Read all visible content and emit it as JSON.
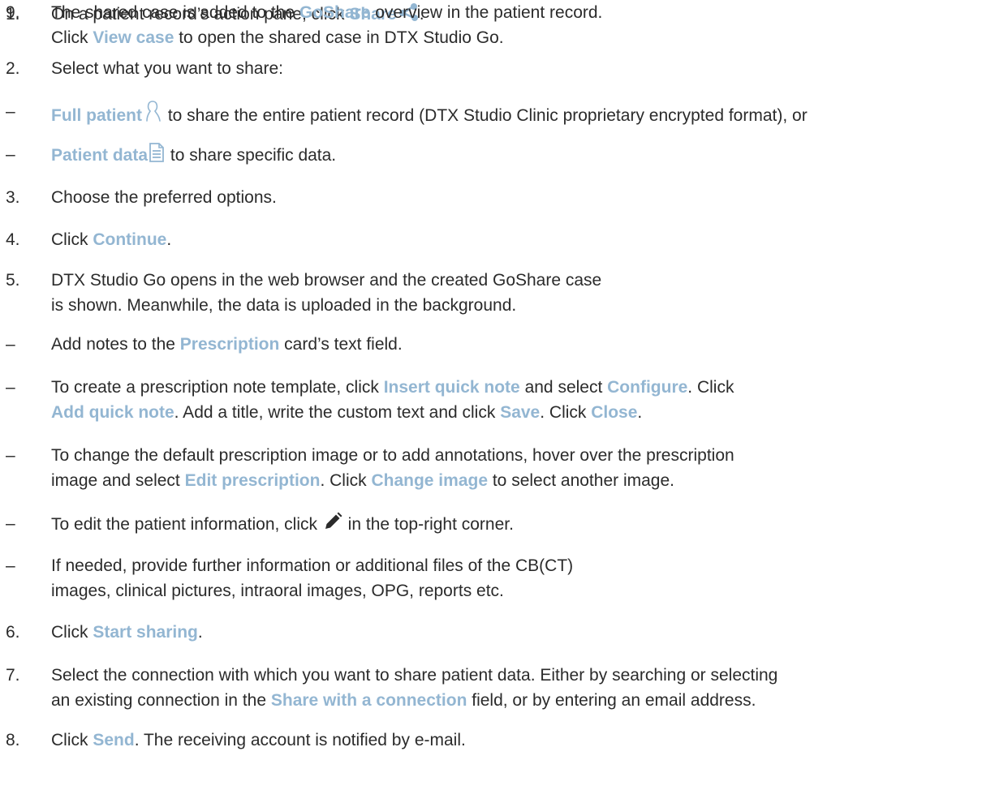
{
  "steps": [
    {
      "marker": "1.",
      "lines": [
        [
          {
            "t": "On a patient record’s action pane, click "
          },
          {
            "t": "Share",
            "hl": true
          },
          {
            "icon": "share-icon"
          },
          {
            "t": "."
          }
        ]
      ]
    },
    {
      "marker": "2.",
      "lines": [
        [
          {
            "t": "Select what you want to share:"
          }
        ]
      ]
    },
    {
      "marker": "–",
      "lines": [
        [
          {
            "t": "Full patient",
            "hl": true
          },
          {
            "icon": "person-outline-icon"
          },
          {
            "t": " to share the entire patient record (DTX Studio Clinic proprietary encrypted format), or"
          }
        ]
      ]
    },
    {
      "marker": "–",
      "lines": [
        [
          {
            "t": "Patient data",
            "hl": true
          },
          {
            "icon": "document-icon"
          },
          {
            "t": " to share specific data."
          }
        ]
      ]
    },
    {
      "marker": "3.",
      "lines": [
        [
          {
            "t": "Choose the preferred options."
          }
        ]
      ]
    },
    {
      "marker": "4.",
      "lines": [
        [
          {
            "t": "Click "
          },
          {
            "t": "Continue",
            "hl": true
          },
          {
            "t": "."
          }
        ]
      ]
    },
    {
      "marker": "5.",
      "lines": [
        [
          {
            "t": "DTX Studio Go opens in the web browser and the created GoShare case"
          }
        ],
        [
          {
            "t": "is shown. Meanwhile, the data is uploaded in the background."
          }
        ]
      ]
    },
    {
      "marker": "–",
      "lines": [
        [
          {
            "t": "Add notes to the "
          },
          {
            "t": "Prescription",
            "hl": true
          },
          {
            "t": " card’s text field."
          }
        ]
      ]
    },
    {
      "marker": "–",
      "lines": [
        [
          {
            "t": "To create a prescription note template, click "
          },
          {
            "t": "Insert quick note",
            "hl": true
          },
          {
            "t": " and select "
          },
          {
            "t": "Configure",
            "hl": true
          },
          {
            "t": ". Click"
          }
        ],
        [
          {
            "t": "Add quick note",
            "hl": true
          },
          {
            "t": ". Add a title, write the custom text and click "
          },
          {
            "t": "Save",
            "hl": true
          },
          {
            "t": ". Click "
          },
          {
            "t": "Close",
            "hl": true
          },
          {
            "t": "."
          }
        ]
      ]
    },
    {
      "marker": "–",
      "lines": [
        [
          {
            "t": "To change the default prescription image or to add annotations, hover over the prescription"
          }
        ],
        [
          {
            "t": "image and select "
          },
          {
            "t": "Edit prescription",
            "hl": true
          },
          {
            "t": ". Click "
          },
          {
            "t": "Change image",
            "hl": true
          },
          {
            "t": " to select another image."
          }
        ]
      ]
    },
    {
      "marker": "–",
      "lines": [
        [
          {
            "t": "To edit the patient information, click "
          },
          {
            "icon": "pencil-icon"
          },
          {
            "t": " in the top-right corner."
          }
        ]
      ]
    },
    {
      "marker": "–",
      "lines": [
        [
          {
            "t": "If needed, provide further information or additional files of the CB(CT)"
          }
        ],
        [
          {
            "t": "images, clinical pictures, intraoral images, OPG, reports etc."
          }
        ]
      ]
    },
    {
      "marker": "6.",
      "lines": [
        [
          {
            "t": "Click "
          },
          {
            "t": "Start sharing",
            "hl": true
          },
          {
            "t": "."
          }
        ]
      ]
    },
    {
      "marker": "7.",
      "lines": [
        [
          {
            "t": "Select the connection with which you want to share patient data. Either by searching or selecting"
          }
        ],
        [
          {
            "t": "an existing connection in the "
          },
          {
            "t": "Share with a connection",
            "hl": true
          },
          {
            "t": " field, or by entering an email address."
          }
        ]
      ]
    },
    {
      "marker": "8.",
      "lines": [
        [
          {
            "t": "Click "
          },
          {
            "t": "Send",
            "hl": true
          },
          {
            "t": ". The receiving account is notified by e-mail."
          }
        ]
      ]
    },
    {
      "marker": "9.",
      "lines": [
        [
          {
            "t": "The shared case is added to the "
          },
          {
            "t": "GoShare",
            "hl": true
          },
          {
            "t": " overview in the patient record."
          }
        ],
        [
          {
            "t": "Click "
          },
          {
            "t": "View case",
            "hl": true
          },
          {
            "t": " to open the shared case in DTX Studio Go."
          }
        ]
      ]
    }
  ],
  "colors": {
    "text": "#2b2b2b",
    "highlight": "#93b6d2",
    "icon": "#93b6d2"
  }
}
